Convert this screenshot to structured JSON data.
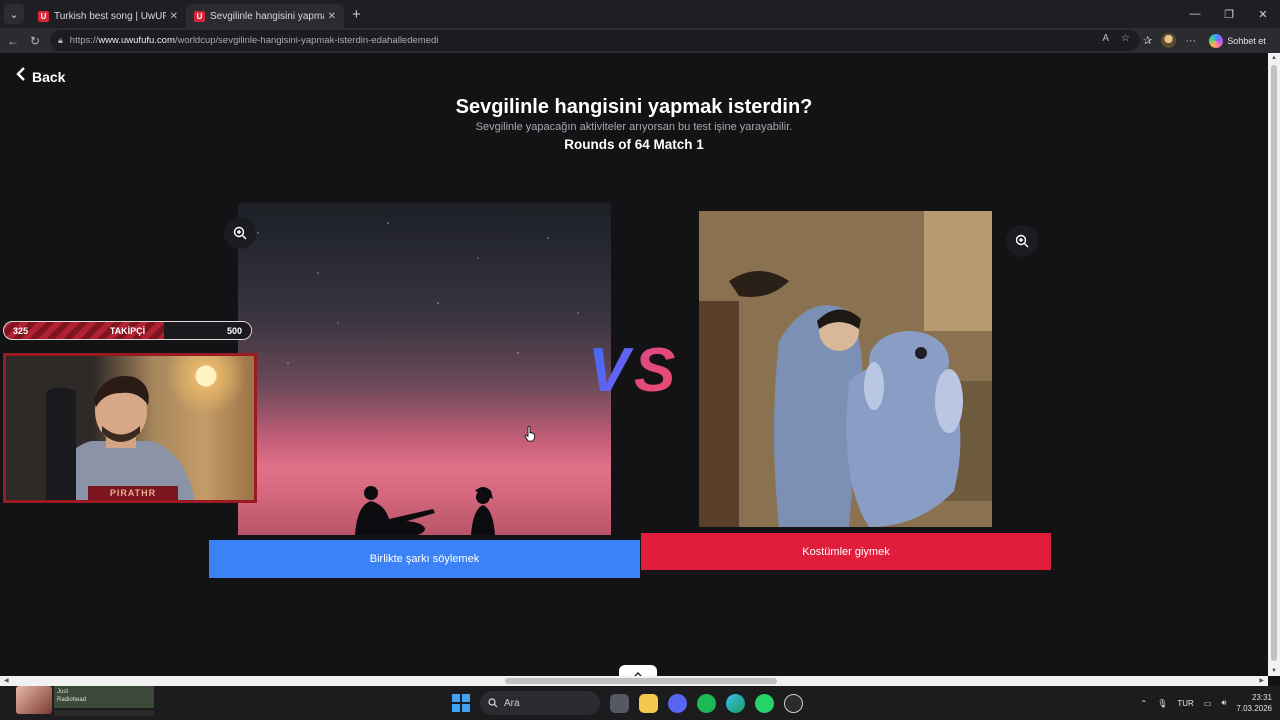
{
  "browser": {
    "tabs": [
      {
        "title": "Turkish best song | UwUFUFU",
        "active": false
      },
      {
        "title": "Sevgilinle hangisini yapmak isterdin",
        "active": true
      }
    ],
    "url_prefix": "https://",
    "url_host": "www.uwufufu.com",
    "url_path": "/worldcup/sevgilinle-hangisini-yapmak-isterdin-edahalledemedi",
    "copilot_label": "Sohbet et"
  },
  "page": {
    "back_label": "Back",
    "title": "Sevgilinle hangisini yapmak isterdin?",
    "subtitle": "Sevgilinle yapacağın aktiviteler arıyorsan bu test işine yarayabilir.",
    "round": "Rounds of 64 Match 1",
    "vs_label": "VS",
    "choices": [
      {
        "label": "Birlikte şarkı söylemek",
        "color": "#3b82f6"
      },
      {
        "label": "Kostümler giymek",
        "color": "#e11d3c"
      }
    ]
  },
  "overlay": {
    "follower_min": "325",
    "follower_label": "TAKİPÇİ",
    "follower_goal": "500",
    "webcam_brand": "PIRATHR"
  },
  "taskbar": {
    "widget_text": "Just",
    "widget_sub": "Radiohead",
    "search_label": "Ara",
    "language": "TUR",
    "time": "23:31",
    "date": "7.03.2026"
  }
}
